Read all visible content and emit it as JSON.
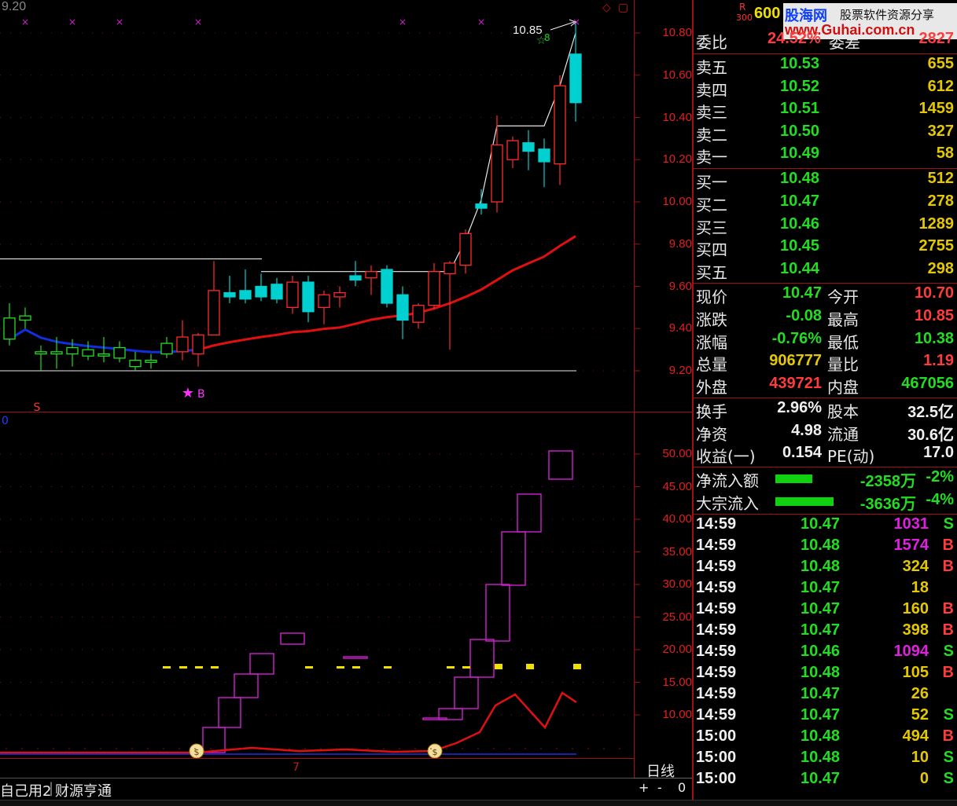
{
  "top_chart": {
    "corner_price": "9.20",
    "max_annotation": "10.85",
    "buy_marker_label": "B",
    "sell_marker_label": "S",
    "green_marker_label": "8",
    "price_axis": [
      "10.80",
      "10.60",
      "10.40",
      "10.20",
      "10.00",
      "9.80",
      "9.60",
      "9.40",
      "9.20"
    ]
  },
  "bottom_chart": {
    "corner_label": "0",
    "axis": [
      "50.00",
      "45.00",
      "40.00",
      "35.00",
      "30.00",
      "25.00",
      "20.00",
      "15.00",
      "10.00"
    ],
    "x_tick_label": "7"
  },
  "period_label": "日线",
  "zoom_controls": {
    "plus": "+",
    "minus": "-",
    "zero": "0"
  },
  "bottom_tabs": [
    "自己用2",
    "财源亨通"
  ],
  "header": {
    "code": "600",
    "r_badge": "R",
    "r_sub": "300",
    "watermark_brand": "股海网",
    "watermark_tagline": "股票软件资源分享",
    "watermark_url": "www.Guhai.com.cn",
    "weibi_label": "委比",
    "weibi_value": "24.52%",
    "weicha_label": "委差",
    "weicha_value": "2827"
  },
  "sell_orders": [
    {
      "label": "卖五",
      "price": "10.53",
      "volume": "655"
    },
    {
      "label": "卖四",
      "price": "10.52",
      "volume": "612"
    },
    {
      "label": "卖三",
      "price": "10.51",
      "volume": "1459"
    },
    {
      "label": "卖二",
      "price": "10.50",
      "volume": "327"
    },
    {
      "label": "卖一",
      "price": "10.49",
      "volume": "58"
    }
  ],
  "buy_orders": [
    {
      "label": "买一",
      "price": "10.48",
      "volume": "512"
    },
    {
      "label": "买二",
      "price": "10.47",
      "volume": "278"
    },
    {
      "label": "买三",
      "price": "10.46",
      "volume": "1289"
    },
    {
      "label": "买四",
      "price": "10.45",
      "volume": "2755"
    },
    {
      "label": "买五",
      "price": "10.44",
      "volume": "298"
    }
  ],
  "quote": {
    "xianjia": {
      "label": "现价",
      "value": "10.47"
    },
    "jinkai": {
      "label": "今开",
      "value": "10.70"
    },
    "zhangdie": {
      "label": "涨跌",
      "value": "-0.08"
    },
    "zuigao": {
      "label": "最高",
      "value": "10.85"
    },
    "zhangfu": {
      "label": "涨幅",
      "value": "-0.76%"
    },
    "zuidi": {
      "label": "最低",
      "value": "10.38"
    },
    "zongliang": {
      "label": "总量",
      "value": "906777"
    },
    "liangbi": {
      "label": "量比",
      "value": "1.19"
    },
    "waipan": {
      "label": "外盘",
      "value": "439721"
    },
    "neipan": {
      "label": "内盘",
      "value": "467056"
    }
  },
  "fundamentals": {
    "huanshou": {
      "label": "换手",
      "value": "2.96%"
    },
    "guben": {
      "label": "股本",
      "value": "32.5亿"
    },
    "jingzi": {
      "label": "净资",
      "value": "4.98"
    },
    "liutong": {
      "label": "流通",
      "value": "30.6亿"
    },
    "shouyi": {
      "label": "收益(一)",
      "value": "0.154"
    },
    "pe": {
      "label": "PE(动)",
      "value": "17.0"
    }
  },
  "flows": [
    {
      "label": "净流入额",
      "amount": "-2358万",
      "pct": "-2%",
      "bar_fraction": 0.3
    },
    {
      "label": "大宗流入",
      "amount": "-3636万",
      "pct": "-4%",
      "bar_fraction": 0.48
    }
  ],
  "ticks": [
    {
      "time": "14:59",
      "price": "10.47",
      "vol": "1031",
      "side": "S",
      "color": "#e020e0"
    },
    {
      "time": "14:59",
      "price": "10.48",
      "vol": "1574",
      "side": "B",
      "color": "#e020e0"
    },
    {
      "time": "14:59",
      "price": "10.48",
      "vol": "324",
      "side": "B",
      "color": "#e6c800"
    },
    {
      "time": "14:59",
      "price": "10.47",
      "vol": "18",
      "side": "",
      "color": "#e6c800"
    },
    {
      "time": "14:59",
      "price": "10.47",
      "vol": "160",
      "side": "B",
      "color": "#e6c800"
    },
    {
      "time": "14:59",
      "price": "10.47",
      "vol": "398",
      "side": "B",
      "color": "#e6c800"
    },
    {
      "time": "14:59",
      "price": "10.46",
      "vol": "1094",
      "side": "S",
      "color": "#e020e0"
    },
    {
      "time": "14:59",
      "price": "10.48",
      "vol": "105",
      "side": "B",
      "color": "#e6c800"
    },
    {
      "time": "14:59",
      "price": "10.47",
      "vol": "26",
      "side": "",
      "color": "#e6c800"
    },
    {
      "time": "14:59",
      "price": "10.47",
      "vol": "52",
      "side": "S",
      "color": "#e6c800"
    },
    {
      "time": "15:00",
      "price": "10.48",
      "vol": "494",
      "side": "B",
      "color": "#e6c800"
    },
    {
      "time": "15:00",
      "price": "10.48",
      "vol": "10",
      "side": "S",
      "color": "#e6c800"
    },
    {
      "time": "15:00",
      "price": "10.47",
      "vol": "0",
      "side": "S",
      "color": "#e6c800"
    }
  ],
  "colors": {
    "up": "#ff2a2a",
    "down": "#00d0d0",
    "ma_red": "#e01010",
    "ma_blue": "#1030e0",
    "ma_white": "#e8e8e8",
    "box": "#d020d0",
    "grid": "#8a1010"
  },
  "chart_data": [
    {
      "type": "candlestick",
      "ylim": [
        9.15,
        10.9
      ],
      "candles": [
        {
          "o": 9.45,
          "h": 9.52,
          "l": 9.32,
          "c": 9.35
        },
        {
          "o": 9.46,
          "h": 9.5,
          "l": 9.4,
          "c": 9.44
        },
        {
          "o": 9.29,
          "h": 9.32,
          "l": 9.2,
          "c": 9.28
        },
        {
          "o": 9.29,
          "h": 9.36,
          "l": 9.21,
          "c": 9.28
        },
        {
          "o": 9.31,
          "h": 9.35,
          "l": 9.22,
          "c": 9.28
        },
        {
          "o": 9.3,
          "h": 9.34,
          "l": 9.25,
          "c": 9.27
        },
        {
          "o": 9.28,
          "h": 9.36,
          "l": 9.24,
          "c": 9.27
        },
        {
          "o": 9.31,
          "h": 9.34,
          "l": 9.24,
          "c": 9.26
        },
        {
          "o": 9.25,
          "h": 9.29,
          "l": 9.2,
          "c": 9.22
        },
        {
          "o": 9.25,
          "h": 9.28,
          "l": 9.21,
          "c": 9.24
        },
        {
          "o": 9.33,
          "h": 9.36,
          "l": 9.26,
          "c": 9.28
        },
        {
          "o": 9.29,
          "h": 9.44,
          "l": 9.25,
          "c": 9.36
        },
        {
          "o": 9.28,
          "h": 9.38,
          "l": 9.22,
          "c": 9.37
        },
        {
          "o": 9.37,
          "h": 9.72,
          "l": 9.37,
          "c": 9.58
        },
        {
          "o": 9.57,
          "h": 9.65,
          "l": 9.52,
          "c": 9.55
        },
        {
          "o": 9.58,
          "h": 9.68,
          "l": 9.52,
          "c": 9.54
        },
        {
          "o": 9.6,
          "h": 9.66,
          "l": 9.53,
          "c": 9.55
        },
        {
          "o": 9.61,
          "h": 9.64,
          "l": 9.52,
          "c": 9.54
        },
        {
          "o": 9.5,
          "h": 9.65,
          "l": 9.47,
          "c": 9.62
        },
        {
          "o": 9.62,
          "h": 9.65,
          "l": 9.43,
          "c": 9.48
        },
        {
          "o": 9.5,
          "h": 9.58,
          "l": 9.42,
          "c": 9.56
        },
        {
          "o": 9.55,
          "h": 9.6,
          "l": 9.5,
          "c": 9.57
        },
        {
          "o": 9.65,
          "h": 9.72,
          "l": 9.6,
          "c": 9.63
        },
        {
          "o": 9.64,
          "h": 9.7,
          "l": 9.56,
          "c": 9.67
        },
        {
          "o": 9.68,
          "h": 9.7,
          "l": 9.5,
          "c": 9.52
        },
        {
          "o": 9.56,
          "h": 9.6,
          "l": 9.35,
          "c": 9.44
        },
        {
          "o": 9.43,
          "h": 9.52,
          "l": 9.4,
          "c": 9.51
        },
        {
          "o": 9.51,
          "h": 9.71,
          "l": 9.49,
          "c": 9.67
        },
        {
          "o": 9.66,
          "h": 9.72,
          "l": 9.3,
          "c": 9.71
        },
        {
          "o": 9.7,
          "h": 9.87,
          "l": 9.66,
          "c": 9.85
        },
        {
          "o": 9.99,
          "h": 10.06,
          "l": 9.94,
          "c": 9.97
        },
        {
          "o": 10.0,
          "h": 10.41,
          "l": 9.95,
          "c": 10.27
        },
        {
          "o": 10.2,
          "h": 10.31,
          "l": 10.16,
          "c": 10.29
        },
        {
          "o": 10.28,
          "h": 10.34,
          "l": 10.15,
          "c": 10.24
        },
        {
          "o": 10.25,
          "h": 10.3,
          "l": 10.07,
          "c": 10.19
        },
        {
          "o": 10.18,
          "h": 10.6,
          "l": 10.08,
          "c": 10.55
        },
        {
          "o": 10.7,
          "h": 10.85,
          "l": 10.38,
          "c": 10.47
        }
      ]
    },
    {
      "type": "box",
      "ylim": [
        0,
        55
      ],
      "series": [
        {
          "name": "",
          "points": [
            [
              245,
              0.5
            ],
            [
              283,
              5
            ],
            [
              303,
              10
            ],
            [
              323,
              14
            ],
            [
              361,
              19
            ],
            [
              384,
              15
            ],
            [
              413,
              21
            ]
          ]
        },
        {
          "name": "",
          "points": [
            [
              557,
              4.5
            ],
            [
              590,
              6
            ],
            [
              603,
              9
            ],
            [
              625,
              13
            ],
            [
              664,
              20
            ],
            [
              700,
              29
            ],
            [
              725,
              39
            ],
            [
              757,
              48
            ],
            [
              780,
              53
            ]
          ]
        }
      ]
    }
  ]
}
